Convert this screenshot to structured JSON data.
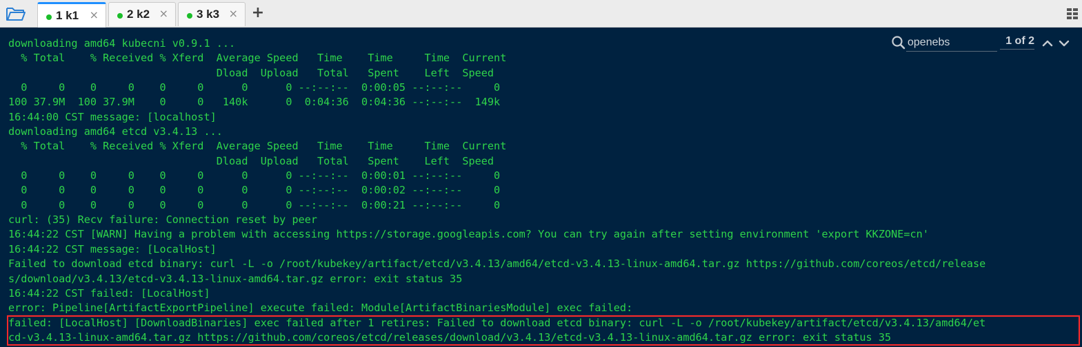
{
  "tabs": [
    {
      "label": "1 k1",
      "active": true
    },
    {
      "label": "2 k2",
      "active": false
    },
    {
      "label": "3 k3",
      "active": false
    }
  ],
  "colors": {
    "terminal_bg": "#002240",
    "terminal_text": "#2fd44a",
    "tab_active_accent": "#1f8fff",
    "status_dot": "#1bbd2a",
    "highlight_border": "#ff2a2a"
  },
  "icons": {
    "open": "folder-icon",
    "tab_close": "close-icon",
    "new_tab": "plus-icon",
    "layout": "grid-icon",
    "search": "search-icon",
    "prev": "chevron-up-icon",
    "next": "chevron-down-icon"
  },
  "tab_close_glyph": "×",
  "new_tab_glyph": "+",
  "search": {
    "value": "openebs",
    "count": "1 of 2"
  },
  "terminal": {
    "lines": [
      "downloading amd64 kubecni v0.9.1 ...",
      "  % Total    % Received % Xferd  Average Speed   Time    Time     Time  Current",
      "                                 Dload  Upload   Total   Spent    Left  Speed",
      "  0     0    0     0    0     0      0      0 --:--:--  0:00:05 --:--:--     0",
      "100 37.9M  100 37.9M    0     0   140k      0  0:04:36  0:04:36 --:--:--  149k",
      "16:44:00 CST message: [localhost]",
      "downloading amd64 etcd v3.4.13 ...",
      "  % Total    % Received % Xferd  Average Speed   Time    Time     Time  Current",
      "                                 Dload  Upload   Total   Spent    Left  Speed",
      "  0     0    0     0    0     0      0      0 --:--:--  0:00:01 --:--:--     0",
      "  0     0    0     0    0     0      0      0 --:--:--  0:00:02 --:--:--     0",
      "  0     0    0     0    0     0      0      0 --:--:--  0:00:21 --:--:--     0",
      "curl: (35) Recv failure: Connection reset by peer",
      "16:44:22 CST [WARN] Having a problem with accessing https://storage.googleapis.com? You can try again after setting environment 'export KKZONE=cn'",
      "16:44:22 CST message: [LocalHost]",
      "Failed to download etcd binary: curl -L -o /root/kubekey/artifact/etcd/v3.4.13/amd64/etcd-v3.4.13-linux-amd64.tar.gz https://github.com/coreos/etcd/release",
      "s/download/v3.4.13/etcd-v3.4.13-linux-amd64.tar.gz error: exit status 35",
      "16:44:22 CST failed: [LocalHost]",
      "error: Pipeline[ArtifactExportPipeline] execute failed: Module[ArtifactBinariesModule] exec failed:",
      "failed: [LocalHost] [DownloadBinaries] exec failed after 1 retires: Failed to download etcd binary: curl -L -o /root/kubekey/artifact/etcd/v3.4.13/amd64/et",
      "cd-v3.4.13-linux-amd64.tar.gz https://github.com/coreos/etcd/releases/download/v3.4.13/etcd-v3.4.13-linux-amd64.tar.gz error: exit status 35"
    ]
  }
}
